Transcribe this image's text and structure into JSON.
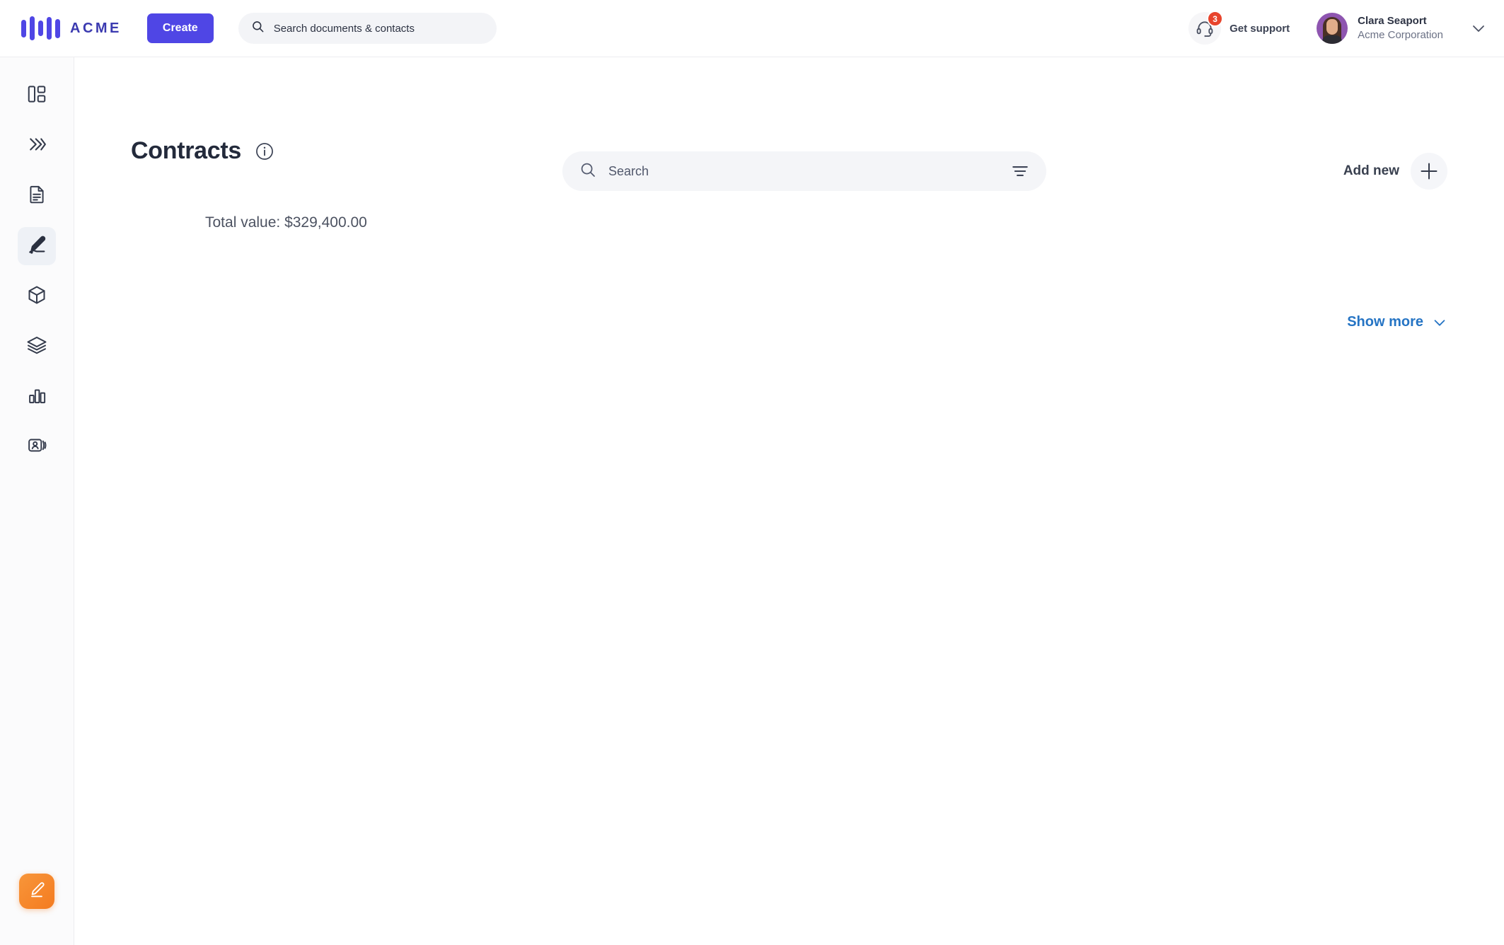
{
  "brand": {
    "name": "ACME",
    "logo_icon": "bars-logo-icon",
    "accent_color": "#4f46e5"
  },
  "topbar": {
    "create_label": "Create",
    "search": {
      "placeholder": "Search documents & contacts",
      "value": "",
      "icon": "search-icon"
    },
    "support": {
      "label": "Get support",
      "icon": "headset-icon",
      "badge_count": "3",
      "badge_color": "#e8442c"
    },
    "user": {
      "name": "Clara Seaport",
      "organization": "Acme Corporation",
      "avatar_icon": "avatar",
      "caret_icon": "chevron-down-icon"
    }
  },
  "sidebar": {
    "items": [
      {
        "name": "dashboard",
        "icon": "dashboard-layout-icon",
        "active": false
      },
      {
        "name": "workflows",
        "icon": "double-chevron-right-icon",
        "active": false
      },
      {
        "name": "documents",
        "icon": "document-icon",
        "active": false
      },
      {
        "name": "contracts",
        "icon": "pencil-signature-icon",
        "active": true
      },
      {
        "name": "products",
        "icon": "cube-icon",
        "active": false
      },
      {
        "name": "templates",
        "icon": "layers-icon",
        "active": false
      },
      {
        "name": "reports",
        "icon": "bar-chart-icon",
        "active": false
      },
      {
        "name": "contacts",
        "icon": "contact-card-icon",
        "active": false
      }
    ],
    "fab": {
      "icon": "pencil-signature-icon",
      "color": "#f47b20"
    }
  },
  "main": {
    "title": "Contracts",
    "info_icon": "info-circle-icon",
    "search": {
      "placeholder": "Search",
      "value": "",
      "icon": "search-icon",
      "filter_icon": "filter-icon"
    },
    "add_new": {
      "label": "Add new",
      "icon": "plus-icon"
    },
    "total_value": "Total value: $329,400.00",
    "show_more": {
      "label": "Show more",
      "icon": "chevron-down-icon",
      "color": "#2574c4"
    },
    "rows": []
  }
}
